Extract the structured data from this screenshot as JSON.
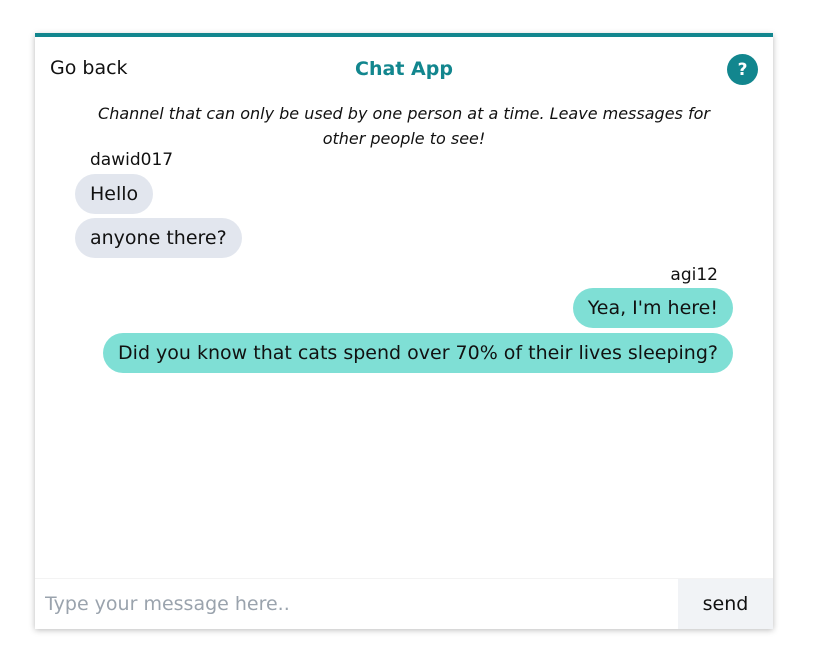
{
  "header": {
    "back_label": "Go back",
    "title": "Chat App",
    "help_label": "?"
  },
  "channel": {
    "description": "Channel that can only be used by one person at a time. Leave messages for other people to see!"
  },
  "conversation": [
    {
      "user": "dawid017",
      "side": "left",
      "messages": [
        "Hello",
        "anyone there?"
      ]
    },
    {
      "user": "agi12",
      "side": "right",
      "messages": [
        "Yea, I'm here!",
        "Did you know that cats spend over 70% of their lives sleeping?"
      ]
    }
  ],
  "composer": {
    "placeholder": "Type your message here..",
    "value": "",
    "send_label": "send"
  },
  "colors": {
    "accent": "#12868e",
    "incoming_bubble": "#e2e6ee",
    "outgoing_bubble": "#7fdfd5"
  }
}
